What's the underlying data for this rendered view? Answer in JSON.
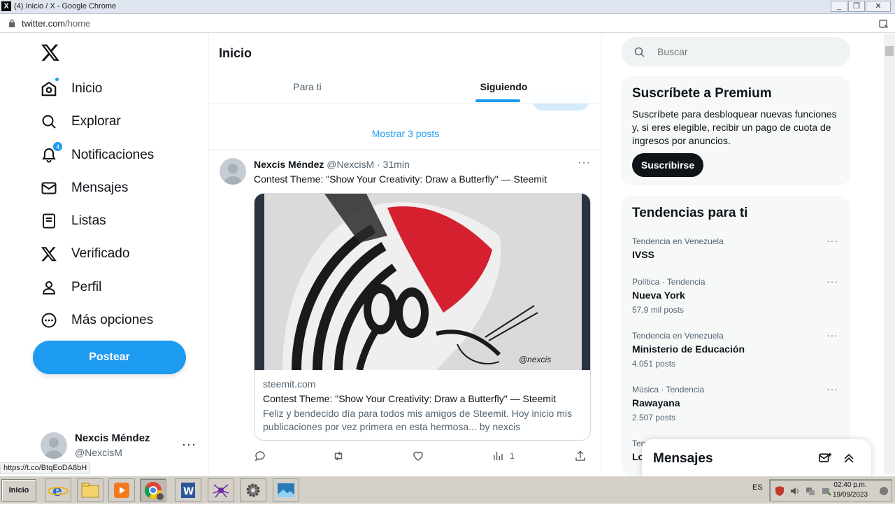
{
  "window": {
    "title": "(4) Inicio / X - Google Chrome",
    "xlogo": "X"
  },
  "address": {
    "host": "twitter.com",
    "path": "/home"
  },
  "nav": {
    "items": [
      {
        "label": "Inicio"
      },
      {
        "label": "Explorar"
      },
      {
        "label": "Notificaciones",
        "badge": "4"
      },
      {
        "label": "Mensajes"
      },
      {
        "label": "Listas"
      },
      {
        "label": "Verificado"
      },
      {
        "label": "Perfil"
      },
      {
        "label": "Más opciones"
      }
    ],
    "post_label": "Postear"
  },
  "account": {
    "name": "Nexcis Méndez",
    "handle": "@NexcisM",
    "more": "···"
  },
  "status_url": "https://t.co/BtqEoDA8bH",
  "timeline": {
    "title": "Inicio",
    "tabs": [
      {
        "label": "Para ti"
      },
      {
        "label": "Siguiendo"
      }
    ],
    "show_more": "Mostrar 3 posts",
    "tweet": {
      "name": "Nexcis Méndez",
      "handle": "@NexcisM",
      "time": "· 31min",
      "more": "···",
      "text": "Contest Theme: \"Show Your Creativity: Draw a Butterfly\" — Steemit",
      "card": {
        "domain": "steemit.com",
        "title": "Contest Theme: \"Show Your Creativity: Draw a Butterfly\" — Steemit",
        "description": "Feliz y bendecido día para todos mis amigos de Steemit. Hoy inicio mis publicaciones por vez primera en esta hermosa... by nexcis",
        "image_signature": "@nexcis"
      },
      "views": "1"
    }
  },
  "search": {
    "placeholder": "Buscar"
  },
  "premium": {
    "title": "Suscríbete a Premium",
    "text": "Suscríbete para desbloquear nuevas funciones y, si eres elegible, recibir un pago de cuota de ingresos por anuncios.",
    "button": "Suscribirse"
  },
  "trends": {
    "title": "Tendencias para ti",
    "items": [
      {
        "context": "Tendencia en Venezuela",
        "name": "IVSS",
        "count": ""
      },
      {
        "context": "Política · Tendencia",
        "name": "Nueva York",
        "count": "57,9 mil posts"
      },
      {
        "context": "Tendencia en Venezuela",
        "name": "Ministerio de Educación",
        "count": "4.051 posts"
      },
      {
        "context": "Música · Tendencia",
        "name": "Rawayana",
        "count": "2.507 posts"
      },
      {
        "context": "Tenc",
        "name": "Lo",
        "count": ""
      }
    ],
    "more": "···"
  },
  "messages_drawer": {
    "title": "Mensajes"
  },
  "taskbar": {
    "start": "Inicio",
    "lang": "ES",
    "time": "02:40 p.m.",
    "date": "19/09/2023"
  },
  "colors": {
    "accent": "#1d9bf0",
    "text": "#0f1419",
    "muted": "#536471"
  }
}
